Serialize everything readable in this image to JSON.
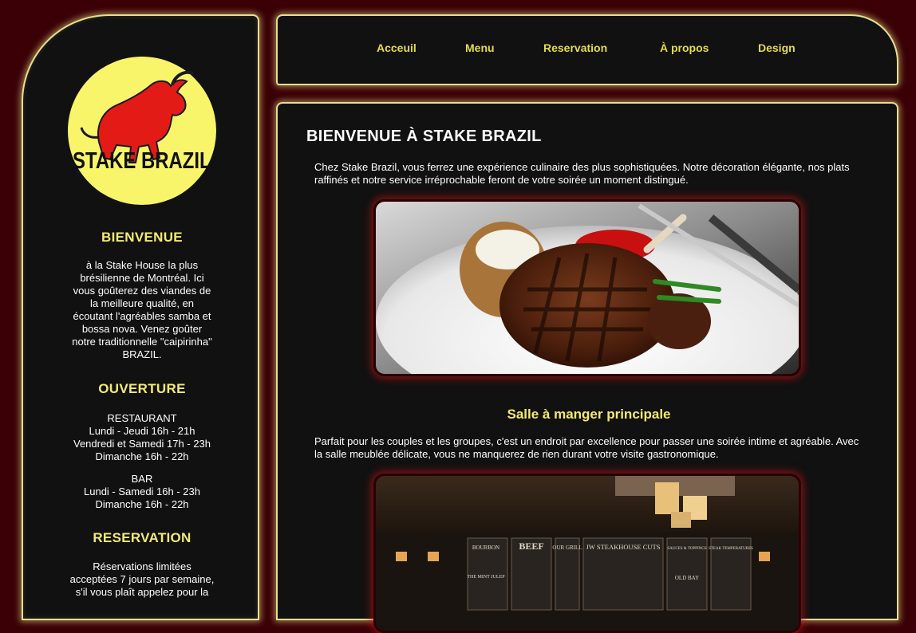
{
  "sidebar": {
    "logo_text": "STAKE BRAZIL",
    "welcome": {
      "heading": "BIENVENUE",
      "lines": [
        "à la Stake House la plus",
        "brésilienne de Montréal. Ici",
        "vous goûterez des viandes de",
        "la meilleure qualité, en",
        "écoutant l'agréables samba et",
        "bossa nova. Venez goûter",
        "notre traditionnelle \"caipirinha\"",
        "BRAZIL."
      ]
    },
    "hours": {
      "heading": "OUVERTURE",
      "restaurant_label": "RESTAURANT",
      "restaurant_lines": [
        "Lundi - Jeudi 16h - 21h",
        "Vendredi et Samedi 17h - 23h",
        "Dimanche 16h - 22h"
      ],
      "bar_label": "BAR",
      "bar_lines": [
        "Lundi - Samedi 16h - 23h",
        "Dimanche 16h - 22h"
      ]
    },
    "reservation": {
      "heading": "RESERVATION",
      "lines": [
        "Réservations limitées",
        "acceptées 7 jours par semaine,",
        "s'il vous plaît appelez pour la"
      ]
    }
  },
  "nav": {
    "items": [
      "Acceuil",
      "Menu",
      "Reservation",
      "À propos",
      "Design"
    ]
  },
  "main": {
    "title": "BIENVENUE À STAKE BRAZIL",
    "intro": "Chez Stake Brazil, vous ferrez une expérience culinaire des plus sophistiquées. Notre décoration élégante, nos plats raffinés et notre service irréprochable feront de votre soirée un moment distingué.",
    "dining_title": "Salle à manger principale",
    "dining_text": "Parfait pour les couples et les groupes, c'est un endroit par excellence pour passer une soirée intime et agréable. Avec la salle meublée délicate, vous ne manquerez de rien durant votre visite gastronomique.",
    "menu_boards": [
      "BOURBON",
      "BEEF",
      "OUR GRILL",
      "JW STEAKHOUSE CUTS",
      "SAUCES & TOPPINGS",
      "STEAK TEMPERATURES",
      "THE MINT JULEP",
      "OLD BAY"
    ]
  },
  "colors": {
    "background": "#3a0006",
    "panel": "#111111",
    "accent": "#f3ea72",
    "nav_link": "#e3dd4a",
    "glow": "#e6e08a",
    "logo_bg": "#f9f56a",
    "bull": "#e21b17"
  }
}
